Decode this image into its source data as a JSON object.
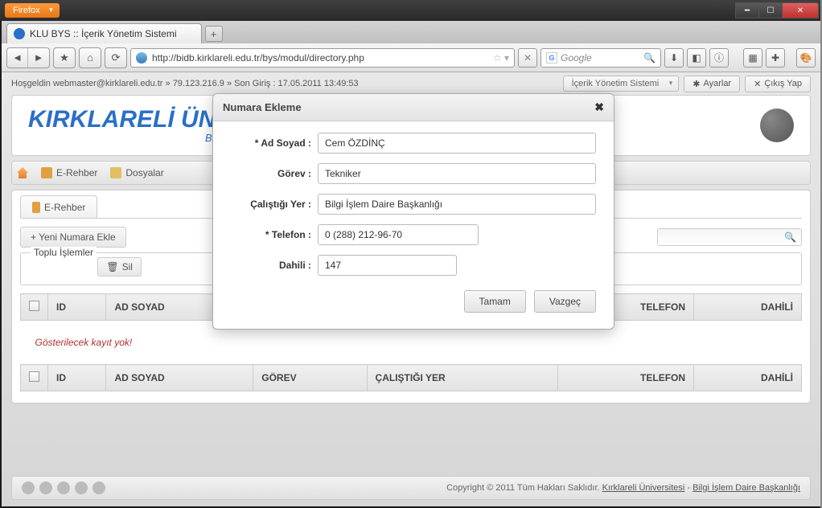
{
  "window": {
    "firefox_label": "Firefox",
    "tab_title": "KLU BYS :: İçerik Yönetim Sistemi",
    "url": "http://bidb.kirklareli.edu.tr/bys/modul/directory.php",
    "search_placeholder": "Google"
  },
  "status_bar": {
    "welcome": "Hoşgeldin webmaster@kirklareli.edu.tr » 79.123.216.9 » Son Giriş : 17.05.2011 13:49:53",
    "dropdown": "İçerik Yönetim Sistemi",
    "settings": "Ayarlar",
    "logout": "Çıkış Yap"
  },
  "banner": {
    "title": "KIRKLARELİ ÜNİ",
    "subtitle": "Bilg"
  },
  "nav": {
    "home": "",
    "erehber": "E-Rehber",
    "dosyalar": "Dosyalar"
  },
  "card": {
    "tab_label": "E-Rehber",
    "add_button": "+ Yeni Numara Ekle",
    "bulk_label": "Toplu İşlemler",
    "delete_button": "Sil",
    "columns": {
      "id": "ID",
      "adsoyad": "AD SOYAD",
      "gorev": "GÖREV",
      "calistigi": "ÇALIŞTIĞI YER",
      "telefon": "TELEFON",
      "dahili": "DAHİLİ"
    },
    "empty_text": "Gösterilecek kayıt yok!"
  },
  "footer": {
    "copyright": "Copyright © 2011 Tüm Hakları Saklıdır. ",
    "link1": "Kırklareli Üniversitesi",
    "sep": " - ",
    "link2": "Bilgi İşlem Daire Başkanlığı"
  },
  "modal": {
    "title": "Numara Ekleme",
    "labels": {
      "adsoyad": "* Ad Soyad :",
      "gorev": "Görev :",
      "calistigi": "Çalıştığı Yer :",
      "telefon": "* Telefon :",
      "dahili": "Dahili :"
    },
    "values": {
      "adsoyad": "Cem ÖZDİNÇ",
      "gorev": "Tekniker",
      "calistigi": "Bilgi İşlem Daire Başkanlığı",
      "telefon": "0 (288) 212-96-70",
      "dahili": "147"
    },
    "ok": "Tamam",
    "cancel": "Vazgeç"
  }
}
